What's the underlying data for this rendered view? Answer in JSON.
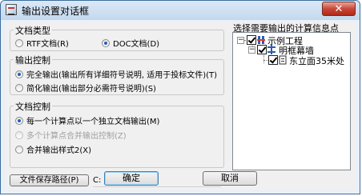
{
  "window": {
    "title": "输出设置对话框",
    "close_glyph": "✕"
  },
  "doc_type": {
    "title": "文档类型",
    "options": [
      {
        "label": "RTF文档(R)",
        "checked": false
      },
      {
        "label": "DOC文档(D)",
        "checked": true
      }
    ]
  },
  "output_control": {
    "title": "输出控制",
    "options": [
      {
        "label": "完全输出(输出所有详细符号说明, 适用于投标文件)(T)",
        "checked": true
      },
      {
        "label": "简化输出(输出部分必需符号说明)(S)",
        "checked": false
      }
    ]
  },
  "doc_control": {
    "title": "文档控制",
    "options": [
      {
        "label": "每一个计算点以一个独立文档输出(M)",
        "checked": true,
        "disabled": false
      },
      {
        "label": "多个计算点合并输出控制(Z)",
        "checked": false,
        "disabled": true
      },
      {
        "label": "合并输出样式2(X)",
        "checked": false,
        "disabled": false
      }
    ]
  },
  "save_path": {
    "button_label": "文件保存路径(P)",
    "value": "C:"
  },
  "tree": {
    "title": "选择需要输出的计算信息点",
    "expander_glyph": "−",
    "nodes": [
      {
        "label": "示例工程",
        "checked": true,
        "expanded": true,
        "icon": "project-icon",
        "level": 0
      },
      {
        "label": "明框幕墙",
        "checked": true,
        "expanded": true,
        "icon": "curtain-wall-icon",
        "level": 1
      },
      {
        "label": "东立面35米处",
        "checked": true,
        "expanded": false,
        "icon": "calc-point-icon",
        "level": 2
      }
    ]
  },
  "buttons": {
    "ok": "确定",
    "cancel": "取消"
  },
  "colors": {
    "accent": "#1f5fbf",
    "close_red": "#c8473a"
  }
}
